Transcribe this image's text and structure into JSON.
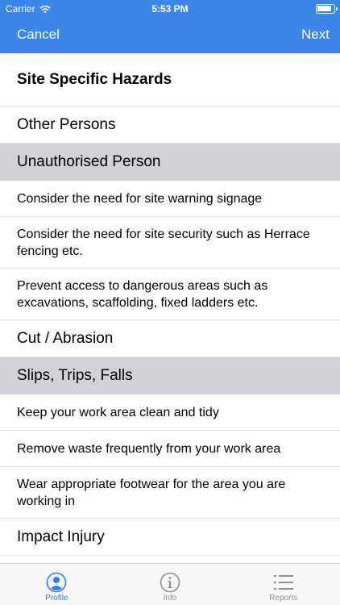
{
  "status_bar": {
    "carrier": "Carrier",
    "time": "5:53 PM"
  },
  "nav": {
    "cancel_label": "Cancel",
    "next_label": "Next"
  },
  "list": {
    "title": "Site Specific Hazards",
    "category_other_persons": "Other Persons",
    "category_unauthorised_person": "Unauthorised Person",
    "unauthorised_items": [
      "Consider the need for site warning signage",
      "Consider the need for site security such as Herrace fencing etc.",
      "Prevent access to dangerous areas such as excavations, scaffolding, fixed ladders etc."
    ],
    "category_cut_abrasion": "Cut / Abrasion",
    "category_slips": "Slips, Trips, Falls",
    "slips_items": [
      "Keep your work area clean and tidy",
      "Remove waste frequently from your work area",
      "Wear appropriate footwear for the area you are working in"
    ],
    "category_impact_injury": "Impact Injury"
  },
  "tabs": [
    {
      "label": "Profile",
      "icon": "profile-icon",
      "active": true
    },
    {
      "label": "Info",
      "icon": "info-icon",
      "active": false
    },
    {
      "label": "Reports",
      "icon": "list-icon",
      "active": false
    }
  ],
  "colors": {
    "accent": "#3b86e8",
    "selected_row": "#d2d2d6",
    "tab_active": "#2f7ef0",
    "tab_inactive": "#8e8e93"
  }
}
